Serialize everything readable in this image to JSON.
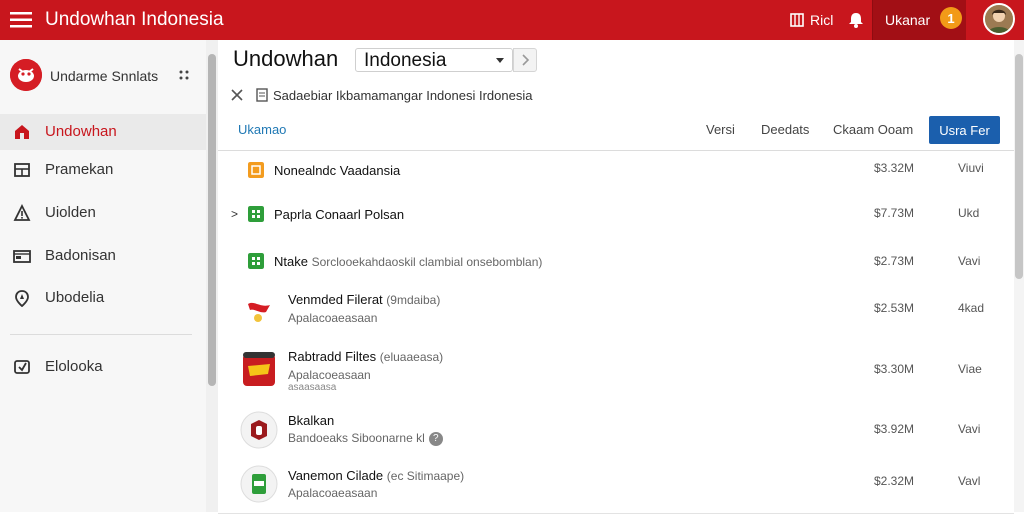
{
  "colors": {
    "accent": "#c8161d",
    "primary_button": "#1b5fad",
    "badge": "#f29a18"
  },
  "topbar": {
    "title": "Undowhan Indonesia",
    "item1_label": "Ricl",
    "user_label": "Ukanar",
    "badge_count": "1"
  },
  "sidebar": {
    "brand": "Undarme Snnlats",
    "items": [
      {
        "label": "Undowhan",
        "icon": "home-icon",
        "active": true
      },
      {
        "label": "Pramekan",
        "icon": "grid-icon"
      },
      {
        "label": "Uiolden",
        "icon": "warning-icon"
      },
      {
        "label": "Badonisan",
        "icon": "card-icon"
      },
      {
        "label": "Ubodelia",
        "icon": "location-icon"
      },
      {
        "label": "Elolooka",
        "icon": "export-icon"
      }
    ]
  },
  "main": {
    "title": "Undowhan",
    "country_select": "Indonesia",
    "breadcrumb": "Sadaebiar Ikbamamangar Indonesi Irdonesia",
    "filter_label": "Ukamao",
    "tools": [
      "Versi",
      "Deedats",
      "Ckaam Ooam"
    ],
    "primary_button": "Usra Fer"
  },
  "rows": [
    {
      "name": "Nonealndc Vaadansia",
      "price": "$3.32M",
      "action": "Viuvi",
      "icon": "orange-square-icon"
    },
    {
      "name": "Paprla Conaarl Polsan",
      "price": "$7.73M",
      "action": "Ukd",
      "icon": "green-square-icon",
      "expander": ">"
    },
    {
      "name": "Ntake",
      "sub": "Sorclooekahdaoskil clambial onsebomblan)",
      "price": "$2.73M",
      "action": "Vavi",
      "icon": "green-square-icon"
    },
    {
      "name": "Venmded Filerat",
      "sub": "(9mdaiba)",
      "desc": "Apalacoaeasaan",
      "price": "$2.53M",
      "action": "4kad",
      "icon": "ribbon-logo-icon"
    },
    {
      "name": "Rabtradd Filtes",
      "sub": "(eluaaeasa)",
      "desc": "Apalacoeasaan",
      "desc2": "asaasaasa",
      "price": "$3.30M",
      "action": "Viae",
      "icon": "red-can-icon"
    },
    {
      "name": "Bkalkan",
      "desc": "Bandoeaks Siboonarne kl",
      "price": "$3.92M",
      "action": "Vavi",
      "icon": "hexagon-logo-icon"
    },
    {
      "name": "Vanemon Cilade",
      "sub": "(ec Sitimaape)",
      "desc": "Apalacoaeasaan",
      "price": "$2.32M",
      "action": "Vavl",
      "icon": "green-cup-icon"
    }
  ]
}
